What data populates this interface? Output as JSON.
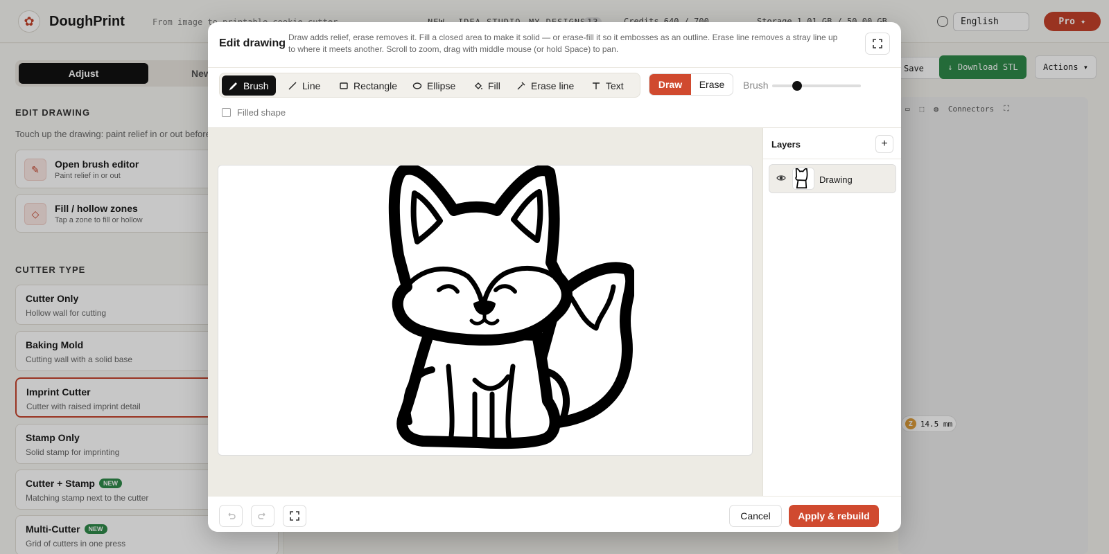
{
  "app": {
    "brand": "DoughPrint",
    "tagline": "From image to printable cookie cutter",
    "nav": [
      "NEW",
      "IDEA STUDIO",
      "MY DESIGNS"
    ],
    "nav_badge": "13",
    "credits": "Credits 640 / 700",
    "storage": "Storage 1.01 GB / 50.00 GB",
    "language": "English",
    "pro_label": "Pro ✦"
  },
  "sidebar": {
    "tabs": [
      "Adjust",
      "New"
    ],
    "edit_section_title": "EDIT DRAWING",
    "edit_section_desc": "Touch up the drawing: paint relief in or out before i",
    "tools": [
      {
        "title": "Open brush editor",
        "subtitle": "Paint relief in or out"
      },
      {
        "title": "Fill / hollow zones",
        "subtitle": "Tap a zone to fill or hollow"
      }
    ],
    "cutter_section_title": "CUTTER TYPE",
    "types": [
      {
        "title": "Cutter Only",
        "subtitle": "Hollow wall for cutting",
        "new": ""
      },
      {
        "title": "Baking Mold",
        "subtitle": "Cutting wall with a solid base",
        "new": ""
      },
      {
        "title": "Imprint Cutter",
        "subtitle": "Cutter with raised imprint detail",
        "new": ""
      },
      {
        "title": "Stamp Only",
        "subtitle": "Solid stamp for imprinting",
        "new": ""
      },
      {
        "title": "Cutter + Stamp",
        "subtitle": "Matching stamp next to the cutter",
        "new": "NEW"
      },
      {
        "title": "Multi-Cutter",
        "subtitle": "Grid of cutters in one press",
        "new": "NEW"
      }
    ]
  },
  "right": {
    "save_label": "Save",
    "download_label": "↓ Download STL",
    "actions_label": "Actions ▾",
    "connectors_label": "Connectors",
    "measure": "14.5 mm",
    "measure_axis": "Z"
  },
  "modal": {
    "title": "Edit drawing",
    "description": "Draw adds relief, erase removes it. Fill a closed area to make it solid — or erase-fill it so it embosses as an outline. Erase line removes a stray line up to where it meets another. Scroll to zoom, drag with middle mouse (or hold Space) to pan.",
    "tools": [
      "Brush",
      "Line",
      "Rectangle",
      "Ellipse",
      "Fill",
      "Erase line",
      "Text"
    ],
    "active_tool": "Brush",
    "draw_label": "Draw",
    "erase_label": "Erase",
    "brush_label": "Brush",
    "brush_size": 0.28,
    "filled_shape_label": "Filled shape",
    "layers_title": "Layers",
    "layers": [
      {
        "name": "Drawing",
        "visible": true
      }
    ],
    "cancel_label": "Cancel",
    "apply_label": "Apply & rebuild"
  },
  "colors": {
    "accent": "#d04a2f",
    "green": "#2f8a4a"
  }
}
